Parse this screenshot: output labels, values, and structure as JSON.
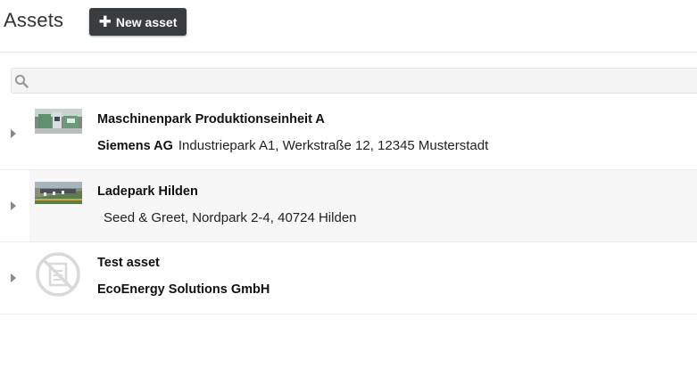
{
  "header": {
    "title": "Assets",
    "new_button_label": "New asset",
    "new_button_icon": "plus-icon"
  },
  "search": {
    "placeholder": "",
    "value": "",
    "icon": "search-icon"
  },
  "assets": [
    {
      "name": "Maschinenpark Produktionseinheit A",
      "owner": "Siemens AG",
      "address": "Industriepark A1, Werkstraße 12, 12345 Musterstadt",
      "thumbnail": "factory-photo"
    },
    {
      "name": "Ladepark Hilden",
      "owner": "",
      "address": "Seed & Greet, Nordpark 2-4, 40724 Hilden",
      "thumbnail": "charging-park-photo"
    },
    {
      "name": "Test asset",
      "owner": "EcoEnergy Solutions GmbH",
      "address": "",
      "thumbnail": "no-image-icon"
    }
  ],
  "colors": {
    "button_bg": "#3a3d40",
    "row_highlight": "#f7f7f7",
    "divider": "#ececec"
  }
}
